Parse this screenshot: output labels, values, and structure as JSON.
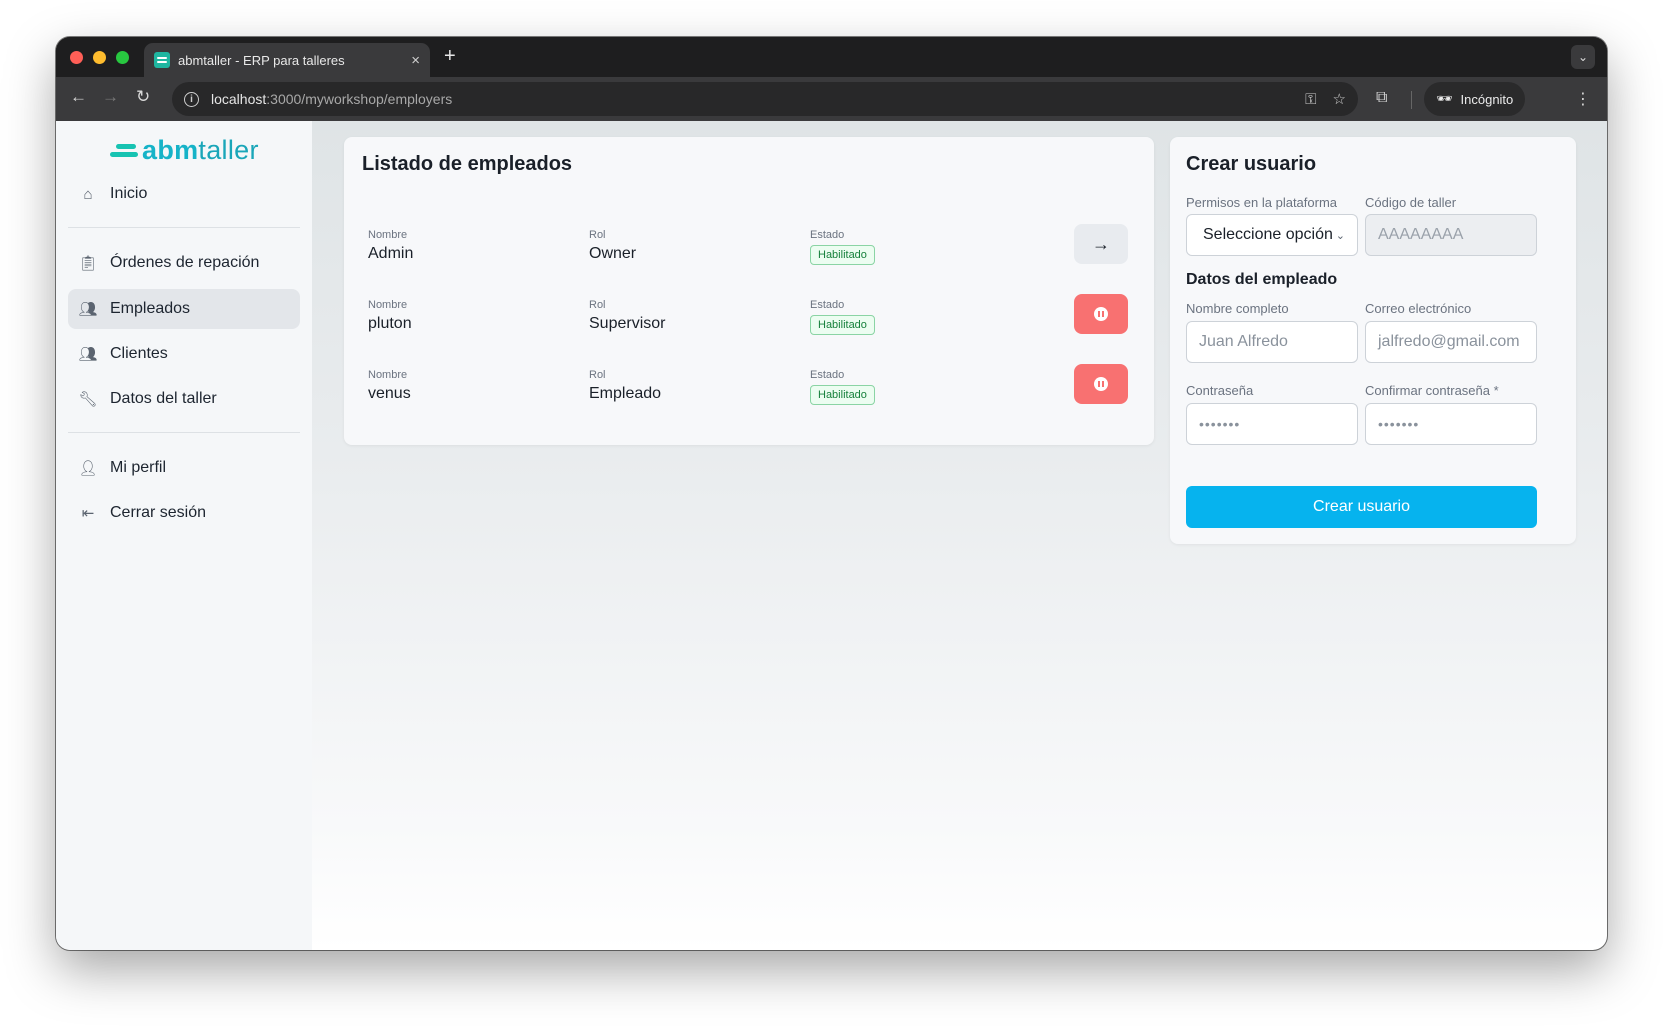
{
  "browser": {
    "tab_title": "abmtaller - ERP para talleres",
    "tab_close": "×",
    "new_tab": "+",
    "url_host": "localhost",
    "url_rest": ":3000/myworkshop/employers",
    "incognito_label": "Incógnito"
  },
  "sidebar": {
    "logo_abm": "abm",
    "logo_taller": "taller",
    "items": [
      {
        "label": "Inicio",
        "icon": "home-icon"
      },
      {
        "label": "Órdenes de repación",
        "icon": "clipboard-icon"
      },
      {
        "label": "Empleados",
        "icon": "users-icon",
        "active": true
      },
      {
        "label": "Clientes",
        "icon": "users-icon"
      },
      {
        "label": "Datos del taller",
        "icon": "wrench-icon"
      },
      {
        "label": "Mi perfil",
        "icon": "user-icon"
      },
      {
        "label": "Cerrar sesión",
        "icon": "logout-icon"
      }
    ]
  },
  "employees": {
    "title": "Listado de empleados",
    "col_name": "Nombre",
    "col_role": "Rol",
    "col_status": "Estado",
    "rows": [
      {
        "name": "Admin",
        "role": "Owner",
        "status": "Habilitado",
        "action": "arrow"
      },
      {
        "name": "pluton",
        "role": "Supervisor",
        "status": "Habilitado",
        "action": "pause"
      },
      {
        "name": "venus",
        "role": "Empleado",
        "status": "Habilitado",
        "action": "pause"
      }
    ],
    "arrow_glyph": "→"
  },
  "create_user": {
    "title": "Crear usuario",
    "permissions_label": "Permisos en la plataforma",
    "permissions_value": "Seleccione opción",
    "workshop_code_label": "Código de taller",
    "workshop_code_placeholder": "AAAAAAAA",
    "section_title": "Datos del empleado",
    "fullname_label": "Nombre completo",
    "fullname_placeholder": "Juan Alfredo",
    "email_label": "Correo electrónico",
    "email_placeholder": "jalfredo@gmail.com",
    "password_label": "Contraseña",
    "password_placeholder": "•••••••",
    "confirm_label": "Confirmar contraseña *",
    "confirm_placeholder": "•••••••",
    "submit_label": "Crear usuario"
  },
  "colors": {
    "accent": "#06b3ee",
    "brand": "#16b3c8",
    "danger": "#f87171",
    "success": "#16803c"
  }
}
